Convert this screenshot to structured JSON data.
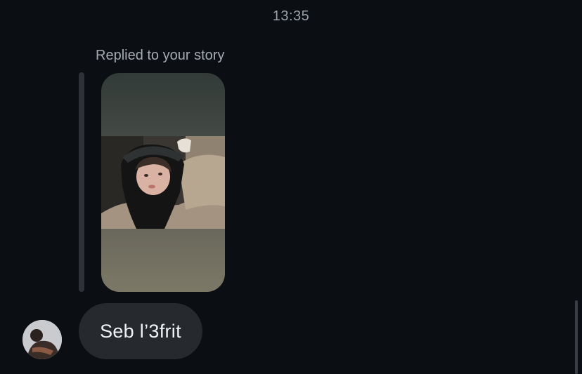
{
  "conversation": {
    "timestamp": "13:35",
    "reply_label": "Replied to your story",
    "message_text": "Seb l’3frit"
  },
  "icons": {
    "avatar": "user-avatar-photo",
    "story": "story-thumbnail-photo"
  },
  "colors": {
    "background": "#0b0e12",
    "bubble": "#26292e",
    "reply_bar": "#2e3238",
    "muted_text": "#9aa0a6",
    "message_text": "#f1f2f4"
  }
}
